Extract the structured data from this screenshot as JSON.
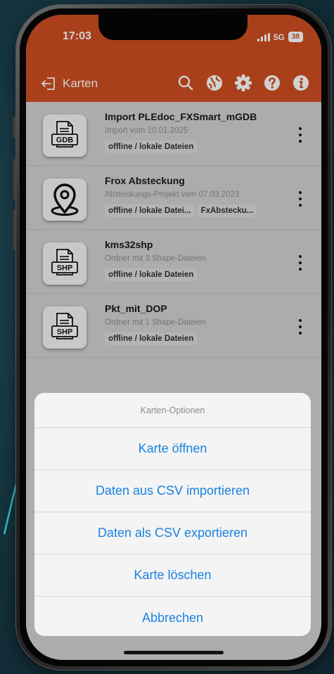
{
  "status": {
    "time": "17:03",
    "network": "5G",
    "battery": "38"
  },
  "nav": {
    "title": "Karten",
    "icons": [
      "search-icon",
      "globe-icon",
      "gear-icon",
      "help-icon",
      "info-icon"
    ]
  },
  "items": [
    {
      "title": "Import PLEdoc_FXSmart_mGDB",
      "subtitle": "Import vom 10.01.2025",
      "chips": [
        "offline / lokale Dateien"
      ],
      "icon": "gdb-file-icon",
      "icon_label": "GDB"
    },
    {
      "title": "Frox Absteckung",
      "subtitle": "Absteckungs-Projekt vom 07.03.2023",
      "chips": [
        "offline / lokale Datei...",
        "FxAbstecku..."
      ],
      "icon": "map-pin-icon",
      "icon_label": ""
    },
    {
      "title": "kms32shp",
      "subtitle": "Ordner mit 3 Shape-Dateien",
      "chips": [
        "offline / lokale Dateien"
      ],
      "icon": "shp-file-icon",
      "icon_label": "SHP"
    },
    {
      "title": "Pkt_mit_DOP",
      "subtitle": "Ordner mit 1 Shape-Dateien",
      "chips": [
        "offline / lokale Dateien"
      ],
      "icon": "shp-file-icon",
      "icon_label": "SHP"
    }
  ],
  "sheet": {
    "title": "Karten-Optionen",
    "options": [
      "Karte öffnen",
      "Daten aus CSV importieren",
      "Daten als CSV exportieren",
      "Karte löschen",
      "Abbrechen"
    ]
  },
  "colors": {
    "header": "#cf4f22",
    "action_text": "#1a82e2"
  }
}
